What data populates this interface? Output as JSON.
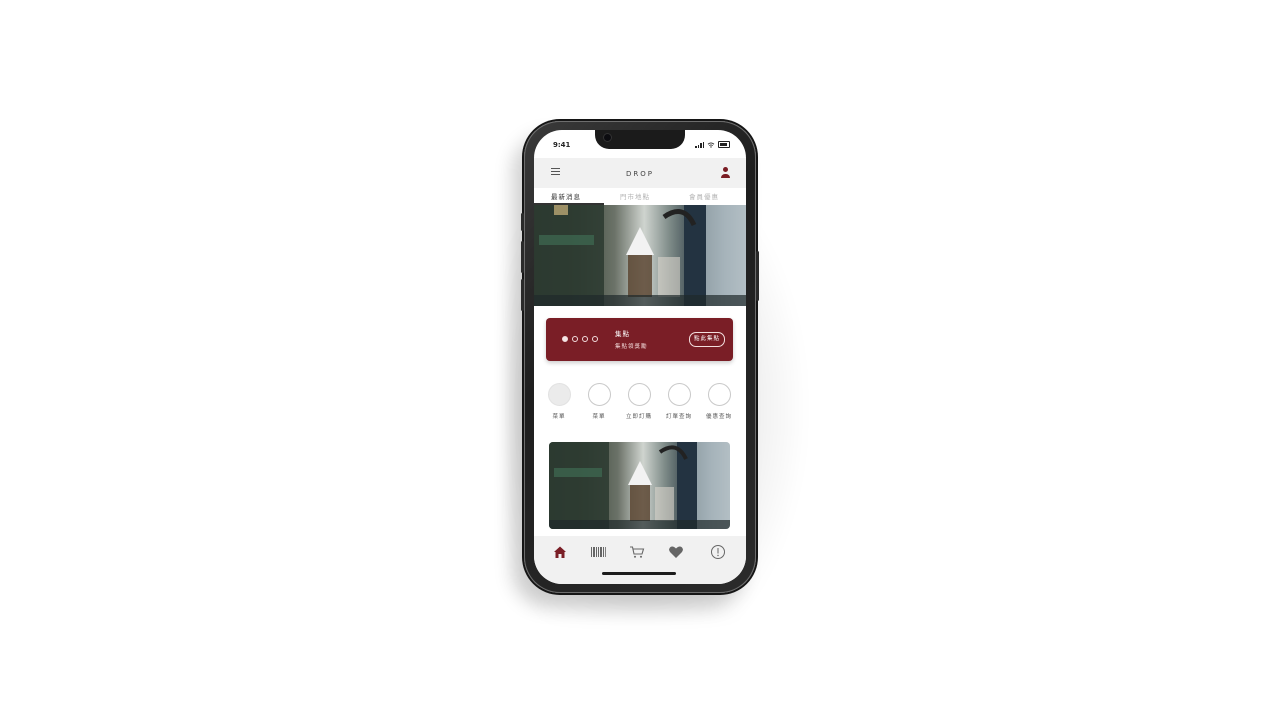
{
  "status_bar": {
    "time": "9:41"
  },
  "header": {
    "brand": "DROP",
    "menu_icon": "menu-icon",
    "profile_icon": "user-icon"
  },
  "tabs": [
    {
      "label": "最新消息",
      "active": true
    },
    {
      "label": "門市地點",
      "active": false
    },
    {
      "label": "會員優惠",
      "active": false
    }
  ],
  "hero": {
    "image": "coffee-pour-over-photo"
  },
  "stamp_card": {
    "title": "集點",
    "subtitle": "集點領獎勵",
    "button_label": "點此集點",
    "stamps_filled": 1,
    "stamps_total": 4
  },
  "shortcuts": [
    {
      "label": "菜單"
    },
    {
      "label": "菜單"
    },
    {
      "label": "立即訂購"
    },
    {
      "label": "訂單查詢"
    },
    {
      "label": "優惠查詢"
    }
  ],
  "promo": {
    "image": "coffee-pour-over-photo"
  },
  "bottom_nav": [
    {
      "icon": "home-icon",
      "active": true
    },
    {
      "icon": "barcode-icon",
      "active": false
    },
    {
      "icon": "cart-icon",
      "active": false
    },
    {
      "icon": "heart-icon",
      "active": false
    },
    {
      "icon": "info-icon",
      "active": false
    }
  ],
  "colors": {
    "accent": "#7a1e26",
    "background": "#ffffff",
    "bar": "#f1f1f1"
  }
}
